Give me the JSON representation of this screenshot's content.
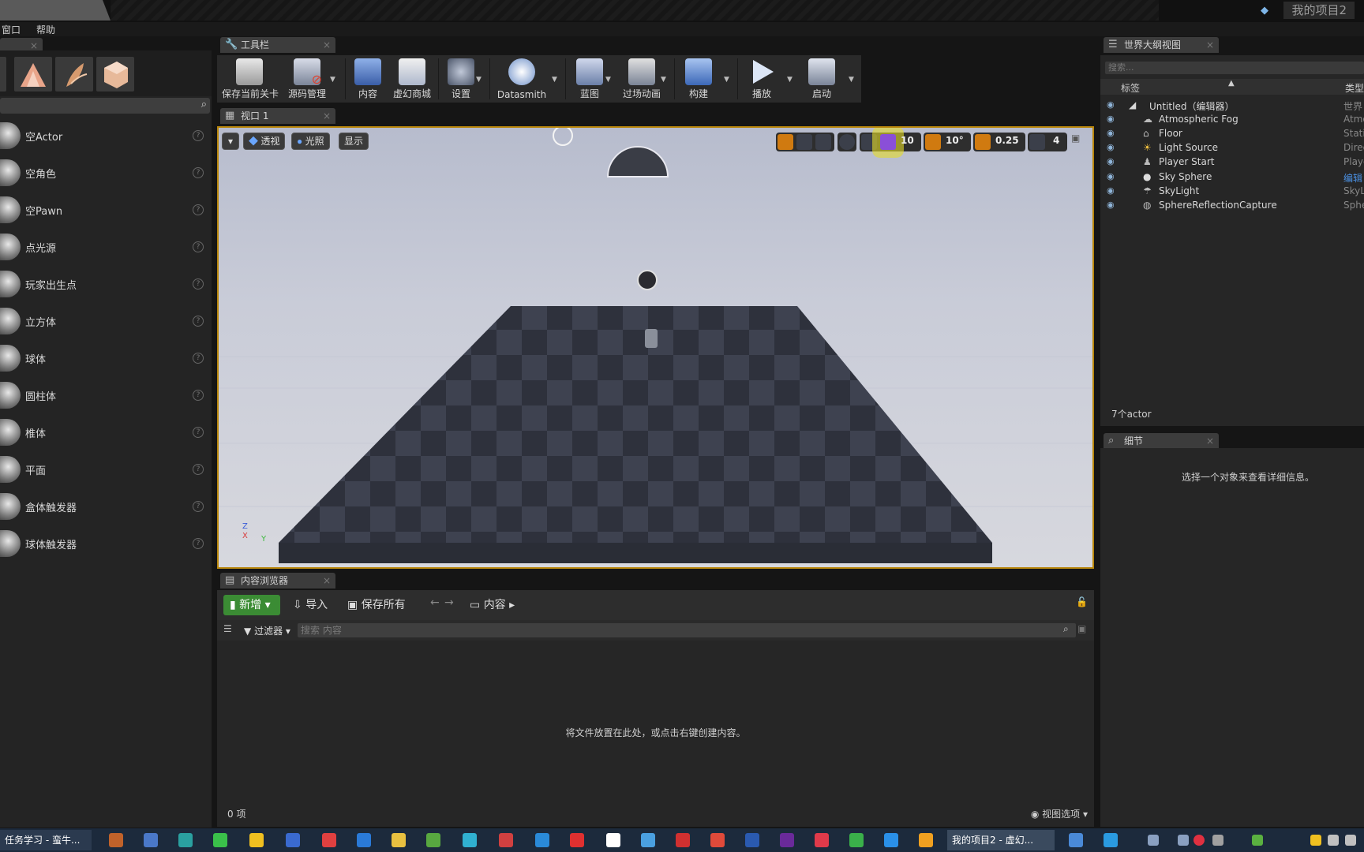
{
  "window": {
    "project_title": "我的项目2"
  },
  "menu": {
    "items": [
      "窗口",
      "帮助"
    ]
  },
  "place_panel": {
    "items": [
      "空Actor",
      "空角色",
      "空Pawn",
      "点光源",
      "玩家出生点",
      "立方体",
      "球体",
      "圆柱体",
      "椎体",
      "平面",
      "盒体触发器",
      "球体触发器"
    ]
  },
  "toolbar": {
    "tab_label": "工具栏",
    "buttons": [
      "保存当前关卡",
      "源码管理",
      "内容",
      "虚幻商城",
      "设置",
      "Datasmith",
      "蓝图",
      "过场动画",
      "构建",
      "播放",
      "启动"
    ]
  },
  "viewport": {
    "tab_label": "视口 1",
    "perspective": "透视",
    "lit": "光照",
    "show": "显示",
    "grid_snap": "10",
    "rot_snap": "10°",
    "scale_snap": "0.25",
    "cam_speed": "4",
    "axis": {
      "z": "Z",
      "x": "X",
      "y": "Y"
    }
  },
  "content_browser": {
    "tab_label": "内容浏览器",
    "new_label": "新增",
    "import_label": "导入",
    "save_all_label": "保存所有",
    "path": "内容",
    "filter_label": "过滤器",
    "search_placeholder": "搜索 内容",
    "empty_msg": "将文件放置在此处，或点击右键创建内容。",
    "count": "0 项",
    "view_options": "视图选项"
  },
  "outliner": {
    "tab_label": "世界大纲视图",
    "search_placeholder": "搜索...",
    "col_label": "标签",
    "col_type": "类型",
    "rows": [
      {
        "name": "Untitled（编辑器）",
        "type": "世界"
      },
      {
        "name": "Atmospheric Fog",
        "type": "Atmo"
      },
      {
        "name": "Floor",
        "type": "Static"
      },
      {
        "name": "Light Source",
        "type": "Direc"
      },
      {
        "name": "Player Start",
        "type": "Playe"
      },
      {
        "name": "Sky Sphere",
        "type": "编辑"
      },
      {
        "name": "SkyLight",
        "type": "SkyL"
      },
      {
        "name": "SphereReflectionCapture",
        "type": "Sphe"
      }
    ],
    "count": "7个actor"
  },
  "details": {
    "tab_label": "细节",
    "hint": "选择一个对象来查看详细信息。"
  },
  "taskbar": {
    "active_left": "任务学习 - 蛮牛...",
    "active_right": "我的项目2 - 虚幻..."
  },
  "colors": {
    "accent": "#b8860b",
    "new_button": "#3b8c34",
    "snap_orange": "#d07a10"
  }
}
